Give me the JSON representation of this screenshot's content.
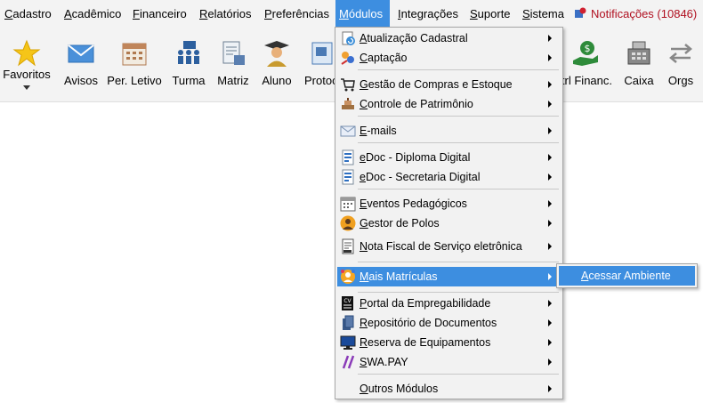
{
  "menubar": {
    "items": [
      "Cadastro",
      "Acadêmico",
      "Financeiro",
      "Relatórios",
      "Preferências",
      "Módulos",
      "Integrações",
      "Suporte",
      "Sistema"
    ],
    "active": "Módulos",
    "notifications": "Notificações (10846)"
  },
  "toolbar": {
    "items": [
      {
        "label": "Favoritos",
        "icon": "star-icon"
      },
      {
        "label": "Avisos",
        "icon": "envelope-icon"
      },
      {
        "label": "Per. Letivo",
        "icon": "calendar-icon"
      },
      {
        "label": "Turma",
        "icon": "class-group-icon"
      },
      {
        "label": "Matriz",
        "icon": "document-matrix-icon"
      },
      {
        "label": "Aluno",
        "icon": "graduate-student-icon"
      },
      {
        "label": "Protoc",
        "icon": "protocol-icon"
      },
      {
        "label": "Ctrl Financ.",
        "icon": "money-hand-icon"
      },
      {
        "label": "Caixa",
        "icon": "cash-register-icon"
      },
      {
        "label": "Orgs",
        "icon": "swap-arrows-icon"
      }
    ]
  },
  "dropdown": {
    "items": [
      {
        "label": "Atualização Cadastral",
        "icon": "update-icon"
      },
      {
        "label": "Captação",
        "icon": "capture-icon"
      },
      {
        "label": "Gestão de Compras e Estoque",
        "icon": "shopping-icon"
      },
      {
        "label": "Controle de Patrimônio",
        "icon": "assets-icon"
      },
      {
        "label": "E-mails",
        "icon": "email-icon"
      },
      {
        "label": "eDoc - Diploma Digital",
        "icon": "edoc-icon"
      },
      {
        "label": "eDoc - Secretaria Digital",
        "icon": "edoc-icon"
      },
      {
        "label": "Eventos Pedagógicos",
        "icon": "calendar-icon"
      },
      {
        "label": "Gestor de Polos",
        "icon": "polo-manager-icon"
      },
      {
        "label": "Nota Fiscal de Serviço eletrônica",
        "icon": "invoice-icon"
      },
      {
        "label": "Mais Matrículas",
        "icon": "enrollment-icon"
      },
      {
        "label": "Portal da Empregabilidade",
        "icon": "cv-icon"
      },
      {
        "label": "Repositório de Documentos",
        "icon": "books-icon"
      },
      {
        "label": "Reserva de Equipamentos",
        "icon": "monitor-icon"
      },
      {
        "label": "SWA.PAY",
        "icon": "swapay-icon"
      },
      {
        "label": "Outros Módulos",
        "icon": ""
      }
    ],
    "highlighted": "Mais Matrículas"
  },
  "submenu": {
    "items": [
      "Acessar Ambiente"
    ]
  },
  "colors": {
    "highlight": "#3d8ee0",
    "bar_bg": "#f3f3f3",
    "notification": "#b01020"
  }
}
